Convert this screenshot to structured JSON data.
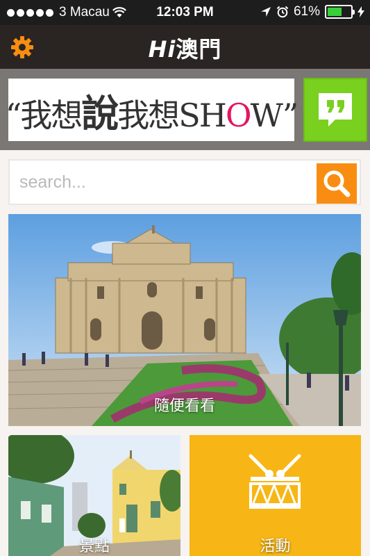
{
  "status_bar": {
    "carrier": "3 Macau",
    "time": "12:03 PM",
    "battery": "61%",
    "battery_level": 0.61
  },
  "header": {
    "logo_hi": "Hi",
    "logo_text": "澳門"
  },
  "banner": {
    "text_part1": "“我想",
    "text_big": "說",
    "text_part2": "我想SH",
    "text_o": "O",
    "text_part3": "W”"
  },
  "search": {
    "placeholder": "search..."
  },
  "tiles": {
    "hero_caption": "隨便看看",
    "sights_caption": "景點",
    "events_caption": "活動"
  },
  "colors": {
    "accent_orange": "#f98d11",
    "accent_green": "#79d01f",
    "events_yellow": "#f7b615",
    "header_bg": "#2a2522"
  }
}
